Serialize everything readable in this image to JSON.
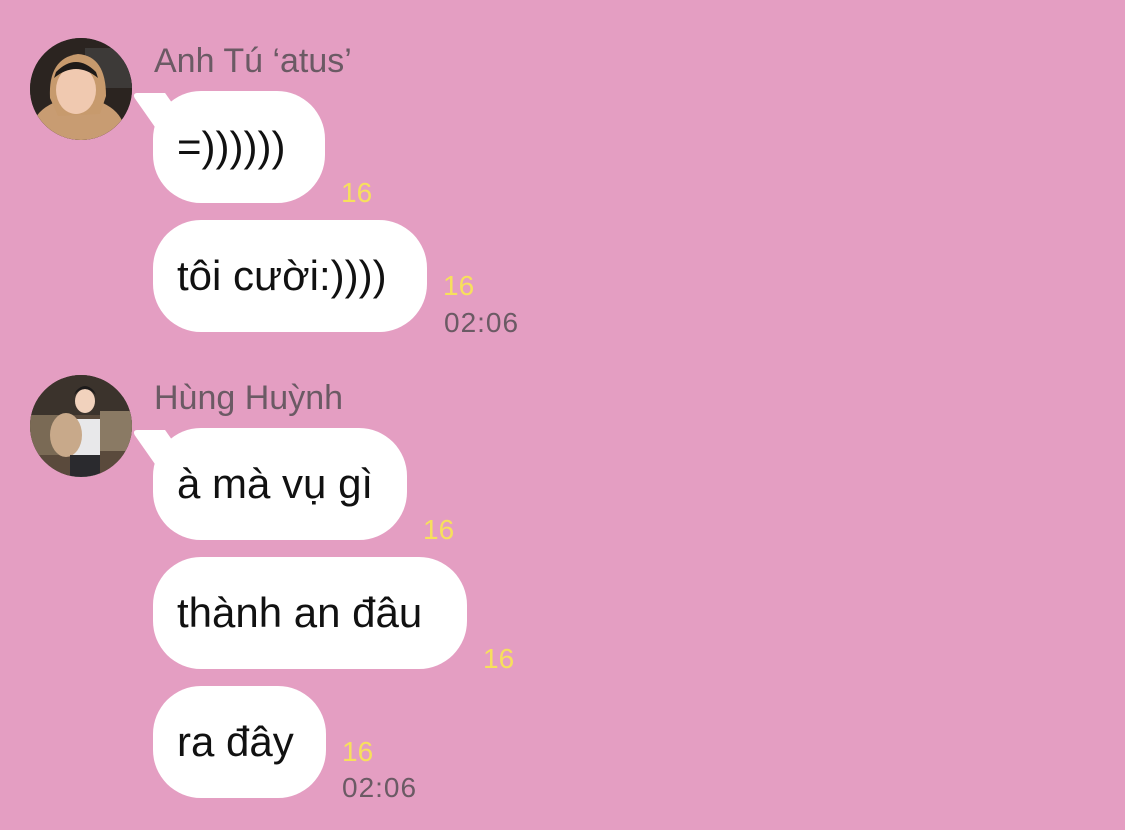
{
  "groups": [
    {
      "sender": "Anh Tú ‘atus’",
      "avatar_icon": "user-avatar-icon",
      "messages": [
        {
          "text": "=))))))",
          "read_count": "16",
          "time": ""
        },
        {
          "text": "tôi cười:))))",
          "read_count": "16",
          "time": "02:06"
        }
      ]
    },
    {
      "sender": "Hùng Huỳnh",
      "avatar_icon": "user-avatar-icon",
      "messages": [
        {
          "text": "à mà vụ gì",
          "read_count": "16",
          "time": ""
        },
        {
          "text": "thành an đâu",
          "read_count": "16",
          "time": ""
        },
        {
          "text": "ra đây",
          "read_count": "16",
          "time": "02:06"
        }
      ]
    }
  ],
  "colors": {
    "background": "#e49ec2",
    "bubble": "#ffffff",
    "read_count": "#f7e05c",
    "meta_text": "#6b5a64"
  }
}
